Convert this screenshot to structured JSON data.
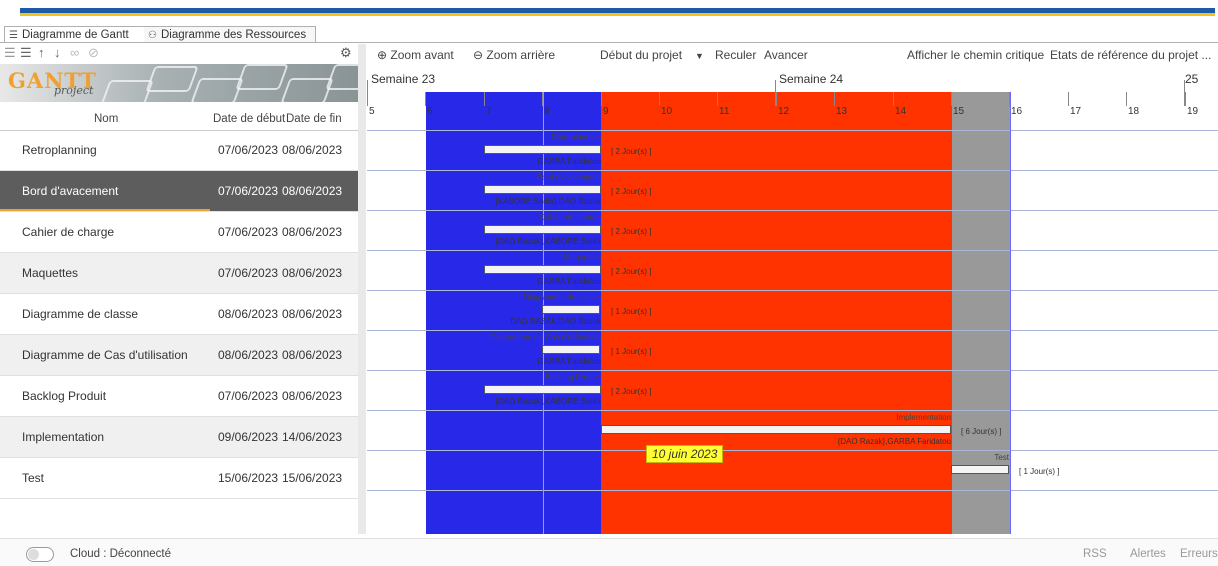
{
  "tabs": [
    {
      "label": "Diagramme de Gantt",
      "icon": "gantt-icon"
    },
    {
      "label": "Diagramme des Ressources",
      "icon": "resources-icon"
    }
  ],
  "logo": {
    "brand": "GANTT",
    "sub": "project"
  },
  "columns": {
    "name": "Nom",
    "start": "Date de début",
    "end": "Date de fin"
  },
  "tasks": [
    {
      "name": "Retroplanning",
      "start": "07/06/2023",
      "end": "08/06/2023"
    },
    {
      "name": "Bord d'avacement",
      "start": "07/06/2023",
      "end": "08/06/2023"
    },
    {
      "name": "Cahier de charge",
      "start": "07/06/2023",
      "end": "08/06/2023"
    },
    {
      "name": "Maquettes",
      "start": "07/06/2023",
      "end": "08/06/2023"
    },
    {
      "name": "Diagramme de classe",
      "start": "08/06/2023",
      "end": "08/06/2023"
    },
    {
      "name": "Diagramme de Cas d'utilisation",
      "start": "08/06/2023",
      "end": "08/06/2023"
    },
    {
      "name": "Backlog Produit",
      "start": "07/06/2023",
      "end": "08/06/2023"
    },
    {
      "name": "Implementation",
      "start": "09/06/2023",
      "end": "14/06/2023"
    },
    {
      "name": "Test",
      "start": "15/06/2023",
      "end": "15/06/2023"
    }
  ],
  "toolbar": {
    "zoom_in": "Zoom avant",
    "zoom_out": "Zoom arrière",
    "project_start": "Début du projet",
    "back": "Reculer",
    "forward": "Avancer",
    "critical_path": "Afficher le chemin critique",
    "baselines": "Etats de référence du projet ..."
  },
  "weeks": [
    "Semaine 23",
    "Semaine 24",
    "25"
  ],
  "days": [
    "5",
    "6",
    "7",
    "8",
    "9",
    "10",
    "11",
    "12",
    "13",
    "14",
    "15",
    "16",
    "17",
    "18",
    "19"
  ],
  "today_label": "10 juin 2023",
  "chart_labels": [
    {
      "title": "Retroplanning",
      "duration": "[ 2 Jour(s) ]",
      "resources": "GARBA Faridatou"
    },
    {
      "title": "Bord d'avacement",
      "duration": "[ 2 Jour(s) ]",
      "resources": "{KABORE Sadia},DAO Razak"
    },
    {
      "title": "Cahier de charge",
      "duration": "[ 2 Jour(s) ]",
      "resources": "{DAO Razak},KABORE Sadia"
    },
    {
      "title": "Maquettes",
      "duration": "[ 2 Jour(s) ]",
      "resources": "GARBA Faridatou"
    },
    {
      "title": "Diagramme de classe",
      "duration": "[ 1 Jour(s) ]",
      "resources": "DAO RAZAK,DAO Razak"
    },
    {
      "title": "Diagramme de Cas d'utilisation",
      "duration": "[ 1 Jour(s) ]",
      "resources": "GARBA Faridatou"
    },
    {
      "title": "Backlog Produit",
      "duration": "[ 2 Jour(s) ]",
      "resources": "{DAO Razak},KABORE Sadia"
    },
    {
      "title": "Implementation",
      "duration": "[ 6 Jour(s) ]",
      "resources": "{DAO Razak},GARBA Faridatou"
    },
    {
      "title": "Test",
      "duration": "[ 1 Jour(s) ]",
      "resources": ""
    }
  ],
  "status": {
    "cloud": "Cloud : Déconnecté",
    "rss": "RSS",
    "alerts": "Alertes",
    "errors": "Erreurs"
  },
  "colors": {
    "blue_band": "#2828e8",
    "red_band": "#ff3300",
    "gray_band": "#999999",
    "accent": "#f0a030"
  }
}
